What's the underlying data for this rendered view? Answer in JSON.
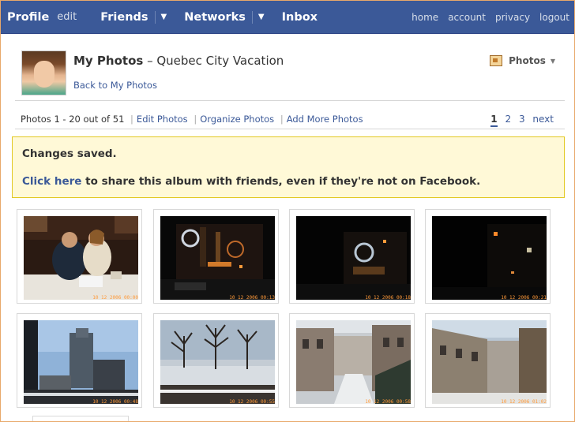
{
  "nav": {
    "profile": "Profile",
    "edit": "edit",
    "friends": "Friends",
    "networks": "Networks",
    "inbox": "Inbox",
    "caret": "▼",
    "right_links": [
      "home",
      "account",
      "privacy",
      "logout"
    ]
  },
  "header": {
    "title_bold": "My Photos",
    "title_dash": " – ",
    "album_name": "Quebec City Vacation",
    "back_link": "Back to My Photos",
    "photos_menu_label": "Photos",
    "photos_menu_arrow": "▼"
  },
  "countbar": {
    "count_text": "Photos 1 - 20 out of 51",
    "links": [
      "Edit Photos",
      "Organize Photos",
      "Add More Photos"
    ],
    "pages": [
      "1",
      "2",
      "3"
    ],
    "next": "next",
    "current_page": "1"
  },
  "notice": {
    "line1": "Changes saved.",
    "link": "Click here",
    "line2_rest": " to share this album with friends, even if they're not on Facebook."
  },
  "photos": [
    {
      "stamp": "10 12 2006 00:00"
    },
    {
      "stamp": "10 12 2006 00:13"
    },
    {
      "stamp": "10 12 2006 00:18"
    },
    {
      "stamp": "10 12 2006 00:21"
    },
    {
      "stamp": "10 12 2006 00:48"
    },
    {
      "stamp": "10 12 2006 00:55"
    },
    {
      "stamp": "10 12 2006 00:58"
    },
    {
      "stamp": "10 12 2006 01:02"
    }
  ],
  "colors": {
    "nav_bg": "#3b5998",
    "link": "#3b5998",
    "notice_bg": "#fff9d7",
    "notice_border": "#e2c822"
  }
}
